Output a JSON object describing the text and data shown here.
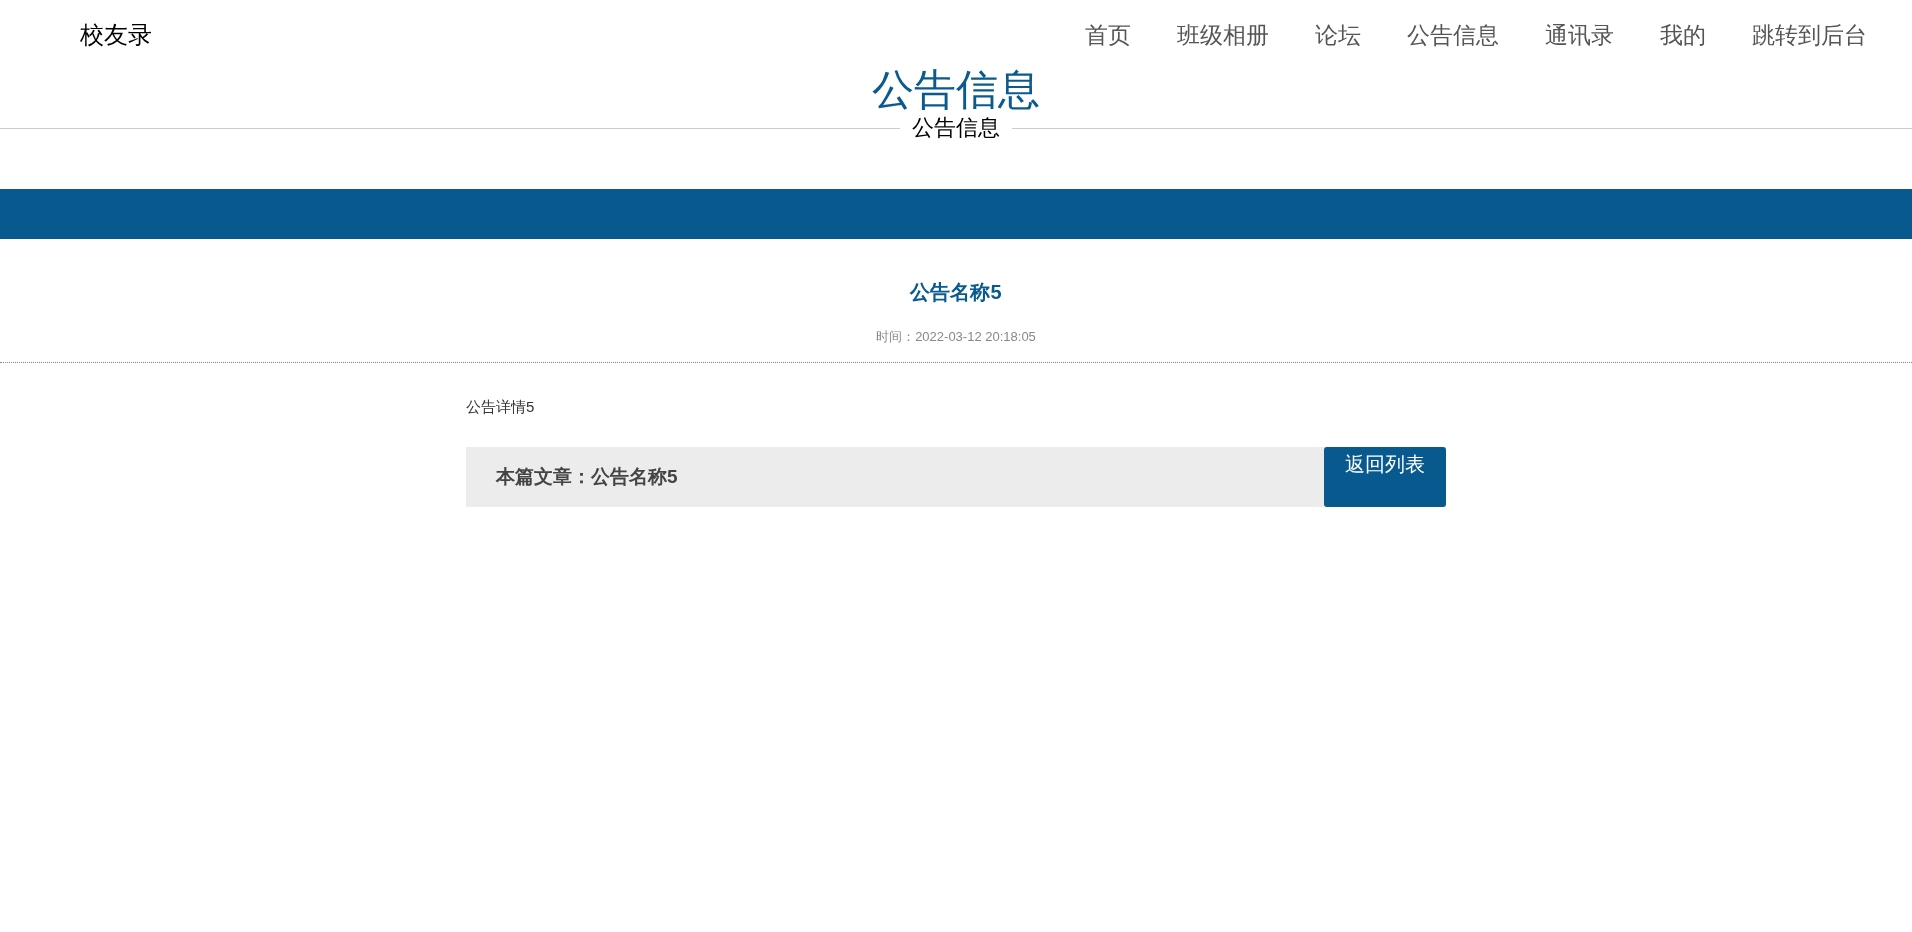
{
  "brand": "校友录",
  "nav": [
    "首页",
    "班级相册",
    "论坛",
    "公告信息",
    "通讯录",
    "我的",
    "跳转到后台"
  ],
  "page_title": "公告信息",
  "page_subtitle": "公告信息",
  "article": {
    "title": "公告名称5",
    "time": "时间：2022-03-12 20:18:05",
    "body": "公告详情5",
    "current": "本篇文章：公告名称5",
    "back_button": "返回列表"
  }
}
